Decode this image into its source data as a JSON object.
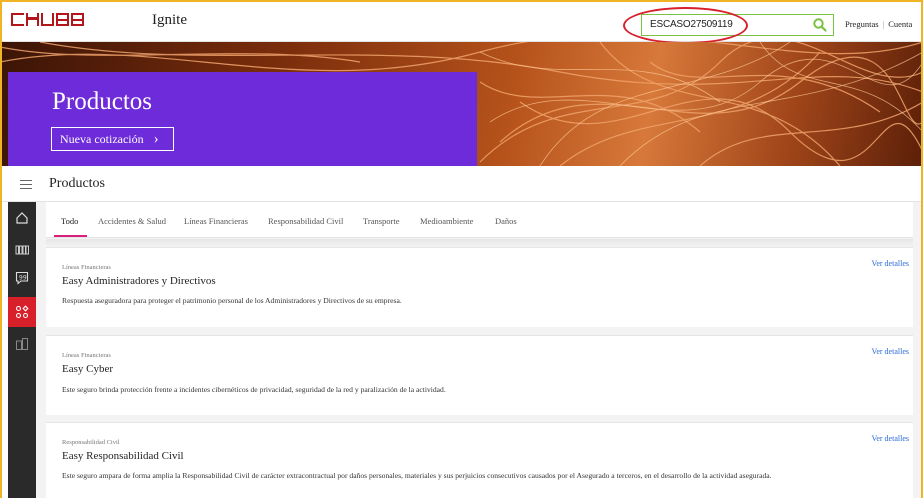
{
  "header": {
    "app_name": "Ignite",
    "search_value": "ESCASO27509119",
    "links": [
      "Preguntas",
      "Cuenta"
    ],
    "link_separator": "|"
  },
  "hero": {
    "title": "Productos",
    "button_label": "Nueva cotización",
    "button_chevron": "›"
  },
  "page": {
    "title": "Productos"
  },
  "tabs": [
    {
      "label": "Todo",
      "active": true
    },
    {
      "label": "Accidentes & Salud"
    },
    {
      "label": "Líneas Financieras"
    },
    {
      "label": "Responsabilidad Civil"
    },
    {
      "label": "Transporte"
    },
    {
      "label": "Medioambiente"
    },
    {
      "label": "Daños"
    }
  ],
  "products": [
    {
      "category": "Líneas Financieras",
      "name": "Easy Administradores y Directivos",
      "description": "Respuesta aseguradora para proteger el patrimonio personal de los Administradores y Directivos de su empresa.",
      "details_label": "Ver detalles"
    },
    {
      "category": "Líneas Financieras",
      "name": "Easy Cyber",
      "description": "Este seguro brinda protección frente a incidentes cibernéticos de privacidad, seguridad de la red y paralización de la actividad.",
      "details_label": "Ver detalles"
    },
    {
      "category": "Responsabilidad Civil",
      "name": "Easy Responsabilidad Civil",
      "description": "Este seguro ampara de forma amplia la Responsabilidad Civil de carácter extracontractual por daños personales, materiales y sus perjuicios consecutivos causados por el Asegurado a terceros, en el desarrollo de la actividad asegurada.",
      "details_label": "Ver detalles"
    }
  ],
  "sidebar": {
    "icons": [
      "home-icon",
      "calculator-icon",
      "quote-icon",
      "products-icon",
      "documents-icon"
    ],
    "active_index": 3
  },
  "colors": {
    "brand_red": "#b3151b",
    "hero_purple": "#6e2bd9",
    "accent_green": "#7bc142",
    "tab_underline": "#d8207c",
    "link_blue": "#2a6ad8",
    "highlight_ring": "#d8202a"
  }
}
